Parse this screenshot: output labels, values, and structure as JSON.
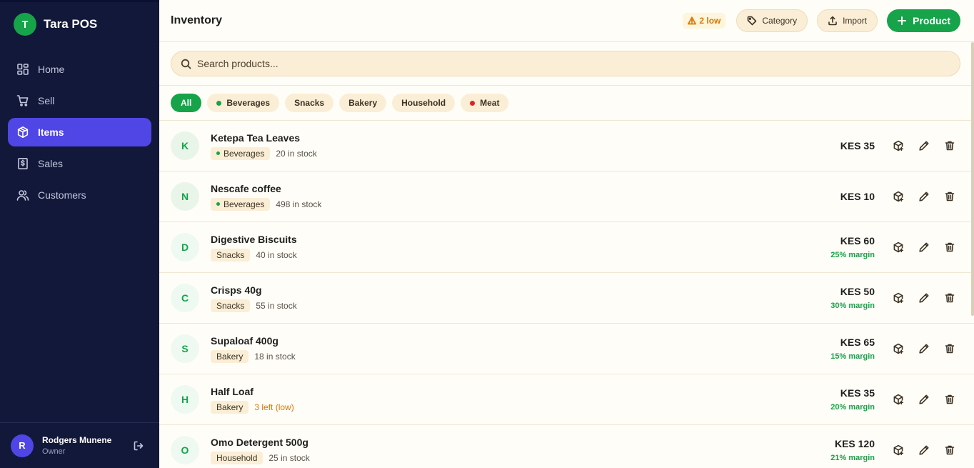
{
  "brand": {
    "initial": "T",
    "name": "Tara POS"
  },
  "nav": [
    {
      "label": "Home",
      "icon": "grid-icon",
      "active": false
    },
    {
      "label": "Sell",
      "icon": "cart-icon",
      "active": false
    },
    {
      "label": "Items",
      "icon": "box-icon",
      "active": true
    },
    {
      "label": "Sales",
      "icon": "receipt-icon",
      "active": false
    },
    {
      "label": "Customers",
      "icon": "users-icon",
      "active": false
    }
  ],
  "user": {
    "initial": "R",
    "name": "Rodgers Munene",
    "role": "Owner"
  },
  "header": {
    "title": "Inventory",
    "low_badge": "2 low",
    "category_label": "Category",
    "import_label": "Import",
    "product_label": "Product"
  },
  "search": {
    "placeholder": "Search products..."
  },
  "filters": [
    {
      "label": "All",
      "active": true,
      "dot": null
    },
    {
      "label": "Beverages",
      "active": false,
      "dot": "#16a34a"
    },
    {
      "label": "Snacks",
      "active": false,
      "dot": null
    },
    {
      "label": "Bakery",
      "active": false,
      "dot": null
    },
    {
      "label": "Household",
      "active": false,
      "dot": null
    },
    {
      "label": "Meat",
      "active": false,
      "dot": "#dc2626"
    }
  ],
  "products": [
    {
      "initial": "K",
      "name": "Ketepa Tea Leaves",
      "category": "Beverages",
      "cat_dot": "#16a34a",
      "stock": "20 in stock",
      "low": false,
      "price": "KES 35",
      "margin": ""
    },
    {
      "initial": "N",
      "name": "Nescafe coffee",
      "category": "Beverages",
      "cat_dot": "#16a34a",
      "stock": "498 in stock",
      "low": false,
      "price": "KES 10",
      "margin": ""
    },
    {
      "initial": "D",
      "name": "Digestive Biscuits",
      "category": "Snacks",
      "cat_dot": null,
      "stock": "40 in stock",
      "low": false,
      "price": "KES 60",
      "margin": "25% margin"
    },
    {
      "initial": "C",
      "name": "Crisps 40g",
      "category": "Snacks",
      "cat_dot": null,
      "stock": "55 in stock",
      "low": false,
      "price": "KES 50",
      "margin": "30% margin"
    },
    {
      "initial": "S",
      "name": "Supaloaf 400g",
      "category": "Bakery",
      "cat_dot": null,
      "stock": "18 in stock",
      "low": false,
      "price": "KES 65",
      "margin": "15% margin"
    },
    {
      "initial": "H",
      "name": "Half Loaf",
      "category": "Bakery",
      "cat_dot": null,
      "stock": "3 left (low)",
      "low": true,
      "price": "KES 35",
      "margin": "20% margin"
    },
    {
      "initial": "O",
      "name": "Omo Detergent 500g",
      "category": "Household",
      "cat_dot": null,
      "stock": "25 in stock",
      "low": false,
      "price": "KES 120",
      "margin": "21% margin"
    }
  ],
  "colors": {
    "sidebar": "#12183a",
    "accent": "#4f46e5",
    "primary": "#16a34a",
    "warning": "#d97706"
  }
}
